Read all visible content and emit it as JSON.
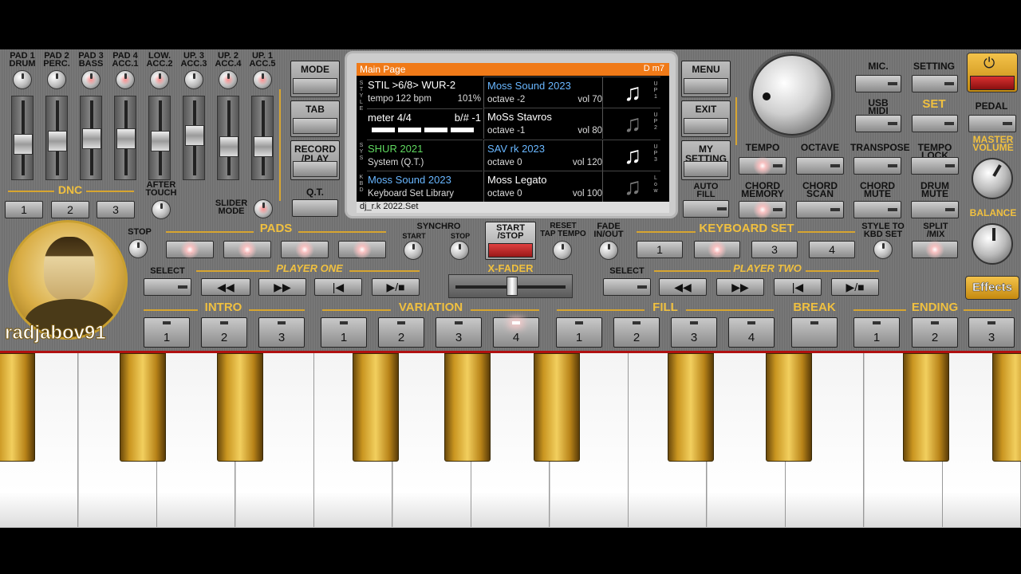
{
  "pad_channels": [
    {
      "label": "PAD 1\nDRUM"
    },
    {
      "label": "PAD 2\nPERC."
    },
    {
      "label": "PAD 3\nBASS"
    },
    {
      "label": "PAD 4\nACC.1"
    },
    {
      "label": "LOW.\nACC.2"
    },
    {
      "label": "UP. 3\nACC.3"
    },
    {
      "label": "UP. 2\nACC.4"
    },
    {
      "label": "UP. 1\nACC.5"
    }
  ],
  "fader_levels": [
    0.45,
    0.5,
    0.55,
    0.55,
    0.5,
    0.6,
    0.4,
    0.4
  ],
  "dnc": {
    "label": "DNC",
    "buttons": [
      "1",
      "2",
      "3"
    ],
    "after_touch": "AFTER\nTOUCH",
    "slider_mode": "SLIDER\nMODE"
  },
  "left_menu": {
    "mode": "MODE",
    "tab": "TAB",
    "record": "RECORD\n/PLAY",
    "qt": "Q.T."
  },
  "screen": {
    "header": "Main Page",
    "chord": "D m7",
    "style_name": "STIL >6/8> WUR-2",
    "tempo": "tempo 122 bpm",
    "tempo_pct": "101%",
    "meter": "meter 4/4",
    "transpose": "b/# -1",
    "set_name": "SHUR 2021",
    "set_sub": "System (Q.T.)",
    "kbd_name": "Moss Sound 2023",
    "kbd_sub": "Keyboard Set Library",
    "footer": "dj_r.k 2022.Set",
    "parts": [
      {
        "name": "Moss Sound 2023",
        "octave": "octave -2",
        "vol": "vol 70",
        "side": "U\nP\n1",
        "active": true
      },
      {
        "name": "MoSs Stavros",
        "octave": "octave -1",
        "vol": "vol 80",
        "side": "U\nP\n2",
        "active": false
      },
      {
        "name": "SAV rk 2023",
        "octave": "octave  0",
        "vol": "vol 120",
        "side": "U\nP\n3",
        "active": true
      },
      {
        "name": "Moss Legato",
        "octave": "octave  0",
        "vol": "vol 100",
        "side": "L\no\nw",
        "active": false
      }
    ],
    "left_tags": {
      "style": "S\nT\nY\nL\nE",
      "sys": "S\nY\nS",
      "kbd": "K\nB\nD"
    }
  },
  "right_menu": {
    "menu": "MENU",
    "exit": "EXIT",
    "my_setting": "MY\nSETTING",
    "auto_fill": "AUTO\nFILL"
  },
  "top_right": {
    "mic": "MIC.",
    "setting": "SETTING",
    "usb_midi": "USB\nMIDI",
    "set": "SET",
    "pedal": "PEDAL",
    "master_volume": "MASTER\nVOLUME",
    "balance": "BALANCE"
  },
  "func_row1": [
    "TEMPO",
    "OCTAVE",
    "TRANSPOSE",
    "TEMPO\nLOCK"
  ],
  "func_row2": [
    "CHORD\nMEMORY",
    "CHORD\nSCAN",
    "CHORD\nMUTE",
    "DRUM\nMUTE"
  ],
  "pads": {
    "label": "PADS",
    "stop": "STOP",
    "buttons": [
      "1",
      "2",
      "3",
      "4"
    ]
  },
  "synchro": {
    "label": "SYNCHRO",
    "start": "START",
    "stop": "STOP"
  },
  "start_stop": "START\n/STOP",
  "reset": "RESET\nTAP TEMPO",
  "fade": "FADE\nIN/OUT",
  "keyboard_set": {
    "label": "KEYBOARD SET",
    "buttons": [
      "1",
      "2",
      "3",
      "4"
    ]
  },
  "style_to_kbd": "STYLE TO\nKBD SET",
  "split_mix": "SPLIT\n/MIX",
  "player_one": {
    "label": "PLAYER ONE",
    "select": "SELECT"
  },
  "player_two": {
    "label": "PLAYER TWO",
    "select": "SELECT"
  },
  "x_fader": "X-FADER",
  "effects": "Effects",
  "username": "radjabov91",
  "sections": {
    "intro": "INTRO",
    "variation": "VARIATION",
    "fill": "FILL",
    "break": "BREAK",
    "ending": "ENDING"
  },
  "intro_buttons": [
    "1",
    "2",
    "3"
  ],
  "variation_buttons": [
    "1",
    "2",
    "3",
    "4"
  ],
  "fill_buttons": [
    "1",
    "2",
    "3",
    "4"
  ],
  "ending_buttons": [
    "1",
    "2",
    "3"
  ],
  "accent_color": "#d7a530"
}
